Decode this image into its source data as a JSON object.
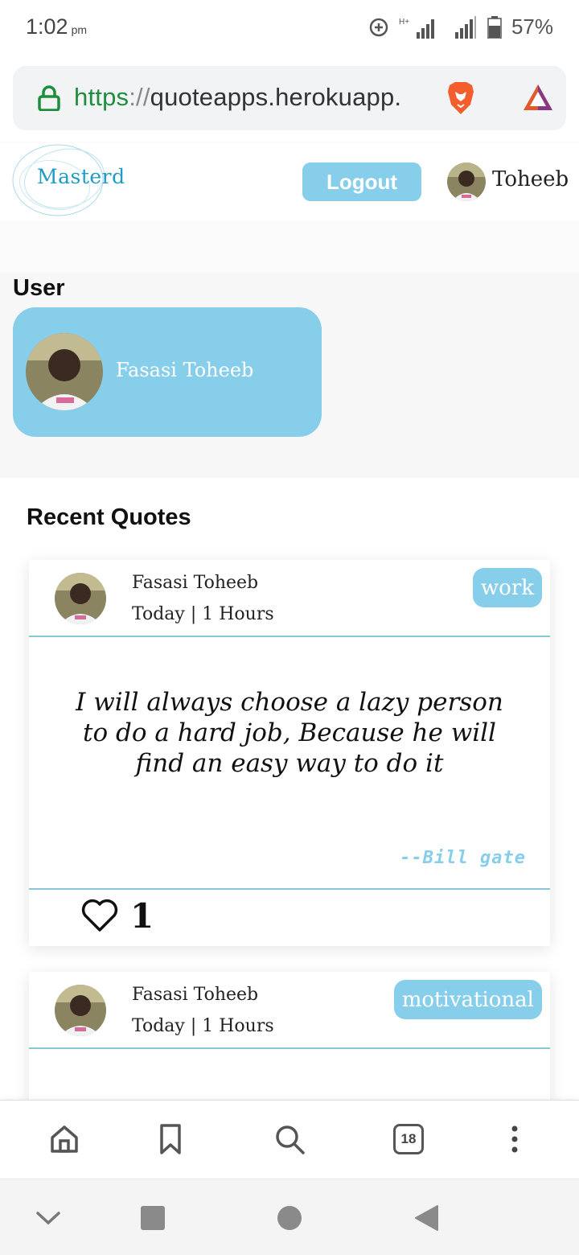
{
  "status_bar": {
    "time": "1:02",
    "ampm": "pm",
    "battery": "57%"
  },
  "browser": {
    "url_scheme": "https",
    "url_separator": "://",
    "url_host": "quoteapps.herokuapp."
  },
  "header": {
    "logo_text": "Masterd",
    "logout_label": "Logout",
    "username": "Toheeb"
  },
  "user_section": {
    "heading": "User",
    "card_name": "Fasasi Toheeb"
  },
  "recent_quotes": {
    "heading": "Recent Quotes",
    "items": [
      {
        "author": "Fasasi Toheeb",
        "time": "Today | 1 Hours",
        "tag": "work",
        "text": "I will always choose a lazy person to do a hard job, Because he will find an easy way to do it",
        "source": "--Bill gate",
        "likes": "1"
      },
      {
        "author": "Fasasi Toheeb",
        "time": "Today | 1 Hours",
        "tag": "motivational"
      }
    ]
  },
  "bottom_bar": {
    "tab_count": "18"
  },
  "colors": {
    "accent": "#87ceeb",
    "https_green": "#1e8e3e"
  }
}
